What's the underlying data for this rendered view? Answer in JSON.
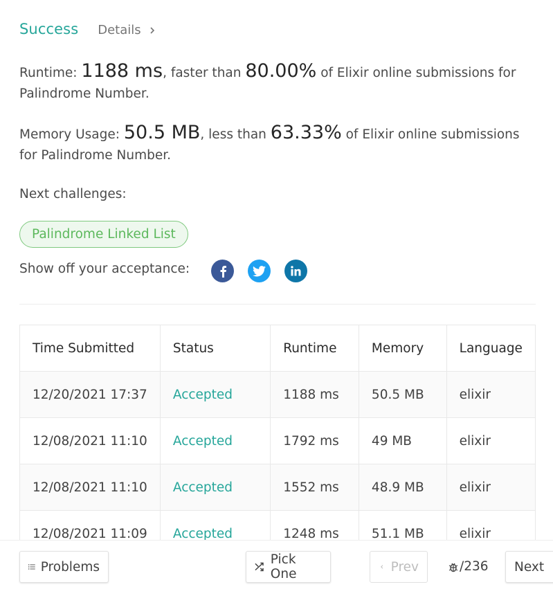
{
  "header": {
    "success": "Success",
    "details": "Details"
  },
  "runtime": {
    "prefix": "Runtime: ",
    "value": "1188 ms",
    "mid": ", faster than ",
    "percent": "80.00%",
    "suffix": " of Elixir online submissions for Palindrome Number."
  },
  "memory": {
    "prefix": "Memory Usage: ",
    "value": "50.5 MB",
    "mid": ", less than ",
    "percent": "63.33%",
    "suffix": " of Elixir online submissions for Palindrome Number."
  },
  "next_challenges": {
    "label": "Next challenges:",
    "tag": "Palindrome Linked List"
  },
  "share": {
    "label": "Show off your acceptance:",
    "icons": [
      "facebook-icon",
      "twitter-icon",
      "linkedin-icon"
    ]
  },
  "table": {
    "headers": [
      "Time Submitted",
      "Status",
      "Runtime",
      "Memory",
      "Language"
    ],
    "rows": [
      [
        "12/20/2021 17:37",
        "Accepted",
        "1188 ms",
        "50.5 MB",
        "elixir"
      ],
      [
        "12/08/2021 11:10",
        "Accepted",
        "1792 ms",
        "49 MB",
        "elixir"
      ],
      [
        "12/08/2021 11:10",
        "Accepted",
        "1552 ms",
        "48.9 MB",
        "elixir"
      ],
      [
        "12/08/2021 11:09",
        "Accepted",
        "1248 ms",
        "51.1 MB",
        "elixir"
      ]
    ]
  },
  "footer": {
    "problems": "Problems",
    "pick_one": "Pick One",
    "prev": "Prev",
    "counter": "/236",
    "next": "Next"
  },
  "colors": {
    "accent": "#26a69a",
    "tag_green": "#5cb85c",
    "facebook": "#3b5998",
    "twitter": "#1da1f2",
    "linkedin": "#0e76a8"
  }
}
